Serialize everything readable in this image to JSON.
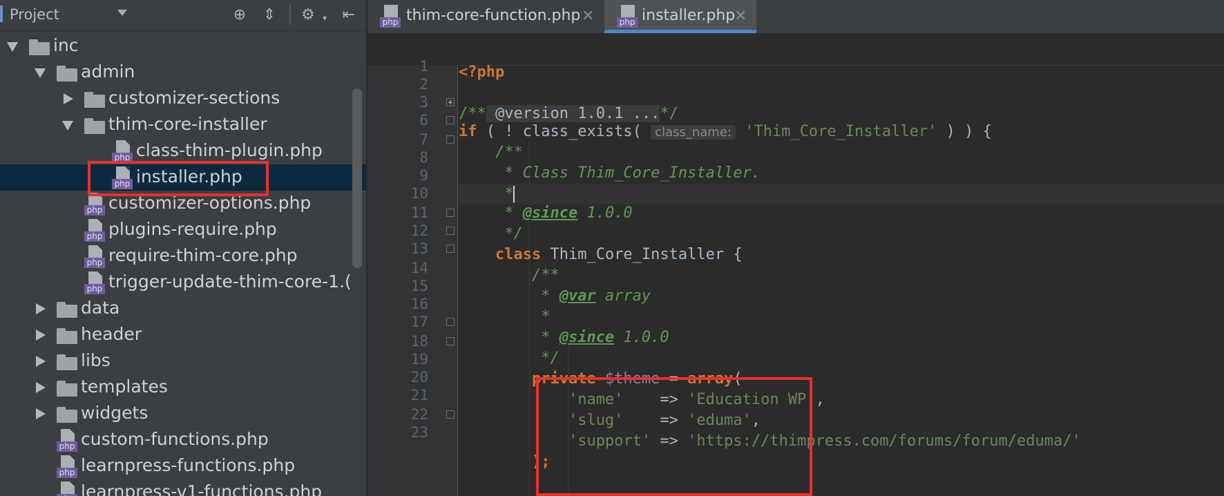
{
  "project_panel": {
    "title": "Project",
    "header_icons": [
      "locate-icon",
      "collapse-all-icon",
      "gear-icon",
      "hide-panel-icon"
    ]
  },
  "tree": [
    {
      "label": "inc",
      "type": "folder",
      "depth": 0,
      "expanded": true
    },
    {
      "label": "admin",
      "type": "folder",
      "depth": 1,
      "expanded": true
    },
    {
      "label": "customizer-sections",
      "type": "folder",
      "depth": 2,
      "expanded": false
    },
    {
      "label": "thim-core-installer",
      "type": "folder",
      "depth": 2,
      "expanded": true
    },
    {
      "label": "class-thim-plugin.php",
      "type": "php",
      "depth": 3
    },
    {
      "label": "installer.php",
      "type": "php",
      "depth": 3,
      "selected": true
    },
    {
      "label": "customizer-options.php",
      "type": "php",
      "depth": 2
    },
    {
      "label": "plugins-require.php",
      "type": "php",
      "depth": 2
    },
    {
      "label": "require-thim-core.php",
      "type": "php",
      "depth": 2
    },
    {
      "label": "trigger-update-thim-core-1.(",
      "type": "php",
      "depth": 2
    },
    {
      "label": "data",
      "type": "folder",
      "depth": 1,
      "expanded": false
    },
    {
      "label": "header",
      "type": "folder",
      "depth": 1,
      "expanded": false
    },
    {
      "label": "libs",
      "type": "folder",
      "depth": 1,
      "expanded": false
    },
    {
      "label": "templates",
      "type": "folder",
      "depth": 1,
      "expanded": false
    },
    {
      "label": "widgets",
      "type": "folder",
      "depth": 1,
      "expanded": false
    },
    {
      "label": "custom-functions.php",
      "type": "php",
      "depth": 1
    },
    {
      "label": "learnpress-functions.php",
      "type": "php",
      "depth": 1
    },
    {
      "label": "learnpress-v1-functions.php",
      "type": "php",
      "depth": 1
    }
  ],
  "file_badge": "php",
  "editor_tabs": [
    {
      "label": "thim-core-function.php",
      "close": "✕",
      "active": false
    },
    {
      "label": "installer.php",
      "close": "✕",
      "active": true
    }
  ],
  "line_numbers": [
    "1",
    "2",
    "3",
    "6",
    "7",
    "8",
    "9",
    "10",
    "11",
    "12",
    "13",
    "14",
    "15",
    "16",
    "17",
    "18",
    "19",
    "20",
    "21",
    "22",
    "23"
  ],
  "code": {
    "l1": "<?php",
    "l3_open": "/**",
    "l3_fold": " @version 1.0.1 ...",
    "l3_close": "*/",
    "l6_if": "if",
    "l6_mid": " ( ! class_exists( ",
    "l6_hint": "class_name:",
    "l6_str": "'Thim_Core_Installer'",
    "l6_end": " ) ) {",
    "l7": "    /**",
    "l8": "     * Class Thim_Core_Installer.",
    "l9": "     *",
    "l10_pre": "     * ",
    "l10_tag": "@since",
    "l10_post": " 1.0.0",
    "l11": "     */",
    "l12_kw": "class",
    "l12_rest": " Thim_Core_Installer {",
    "l13": "        /**",
    "l14_pre": "         * ",
    "l14_tag": "@var",
    "l14_post": " array",
    "l15": "         *",
    "l16_pre": "         * ",
    "l16_tag": "@since",
    "l16_post": " 1.0.0",
    "l17": "         */",
    "l18_kw": "private",
    "l18_var": "$theme",
    "l18_eq": " = ",
    "l18_arr": "array",
    "l18_paren": "(",
    "l19_key": "'name'",
    "l19_arrow": "    => ",
    "l19_val": "'Education WP'",
    "l19_comma": ",",
    "l20_key": "'slug'",
    "l20_arrow": "    => ",
    "l20_val": "'eduma'",
    "l20_comma": ",",
    "l21_key": "'support'",
    "l21_arrow": " => ",
    "l21_val": "'https://thimpress.com/forums/forum/eduma/'",
    "l22": ");"
  },
  "colors": {
    "keyword": "#cc7832",
    "string": "#6a8759",
    "doc_comment": "#629755",
    "variable": "#9876aa",
    "highlight_box": "#e8302c",
    "selection": "#0d293e"
  }
}
